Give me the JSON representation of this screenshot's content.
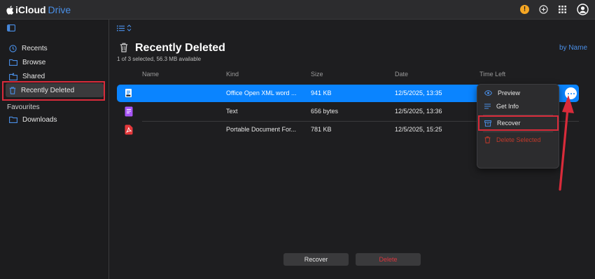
{
  "header": {
    "brand_main": "iCloud",
    "brand_sub": "Drive",
    "warning_badge": "!"
  },
  "sidebar": {
    "items": [
      {
        "label": "Recents",
        "icon": "clock-icon"
      },
      {
        "label": "Browse",
        "icon": "folder-icon"
      },
      {
        "label": "Shared",
        "icon": "shared-folder-icon"
      },
      {
        "label": "Recently Deleted",
        "icon": "trash-icon"
      }
    ],
    "section_label": "Favourites",
    "favourites": [
      {
        "label": "Downloads",
        "icon": "folder-icon"
      }
    ]
  },
  "main": {
    "title": "Recently Deleted",
    "subtitle": "1 of 3 selected, 56.3 MB available",
    "sort_label": "by Name",
    "columns": [
      "Name",
      "Kind",
      "Size",
      "Date",
      "Time Left"
    ],
    "rows": [
      {
        "name": "",
        "kind": "Office Open XML word ...",
        "size": "941 KB",
        "date": "12/5/2025, 13:35",
        "time_left": "",
        "icon": "word-doc-icon",
        "selected": true
      },
      {
        "name": "",
        "kind": "Text",
        "size": "656 bytes",
        "date": "12/5/2025, 13:36",
        "time_left": "",
        "icon": "text-file-icon",
        "selected": false
      },
      {
        "name": "",
        "kind": "Portable Document For...",
        "size": "781 KB",
        "date": "12/5/2025, 15:25",
        "time_left": "",
        "icon": "pdf-file-icon",
        "selected": false
      }
    ]
  },
  "context_menu": {
    "items": [
      {
        "label": "Preview",
        "icon": "eye-icon"
      },
      {
        "label": "Get Info",
        "icon": "info-list-icon"
      },
      {
        "label": "Recover",
        "icon": "recover-icon"
      },
      {
        "label": "Delete Selected",
        "icon": "trash-icon"
      }
    ]
  },
  "footer": {
    "recover_label": "Recover",
    "delete_label": "Delete"
  },
  "colors": {
    "accent": "#0a84ff",
    "link": "#4a8fe7",
    "annotation": "#d92b3a",
    "danger": "#d9363e"
  }
}
